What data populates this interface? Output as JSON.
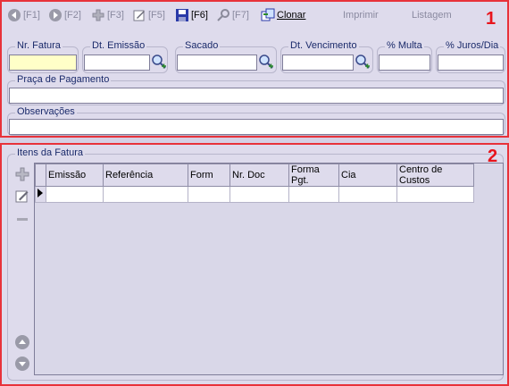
{
  "toolbar": {
    "back": "[F1]",
    "forward": "[F2]",
    "add": "[F3]",
    "edit": "[F5]",
    "save": "[F6]",
    "search": "[F7]",
    "clone": "Clonar",
    "print": "Imprimir",
    "list": "Listagem"
  },
  "markers": {
    "one": "1",
    "two": "2"
  },
  "header": {
    "nr_fatura": {
      "label": "Nr. Fatura",
      "value": ""
    },
    "dt_emissao": {
      "label": "Dt. Emissão",
      "value": ""
    },
    "sacado": {
      "label": "Sacado",
      "value": ""
    },
    "dt_vencimento": {
      "label": "Dt. Vencimento",
      "value": ""
    },
    "multa": {
      "label": "% Multa",
      "value": ""
    },
    "juros": {
      "label": "% Juros/Dia",
      "value": ""
    },
    "praca": {
      "label": "Praça de Pagamento",
      "value": ""
    },
    "observacoes": {
      "label": "Observações",
      "value": ""
    }
  },
  "items": {
    "title": "Itens da Fatura",
    "columns": [
      "Emissão",
      "Referência",
      "Form",
      "Nr. Doc",
      "Forma Pgt.",
      "Cia",
      "Centro de Custos"
    ]
  },
  "colors": {
    "highlight": "#e8323a",
    "background": "#dedbec",
    "required_field": "#ffffc8"
  },
  "icons": [
    "back-arrow-icon",
    "forward-arrow-icon",
    "plus-icon",
    "pencil-icon",
    "floppy-disk-icon",
    "key-search-icon",
    "clone-icon",
    "magnifier-icon",
    "minus-icon",
    "arrow-up-icon",
    "arrow-down-icon"
  ]
}
